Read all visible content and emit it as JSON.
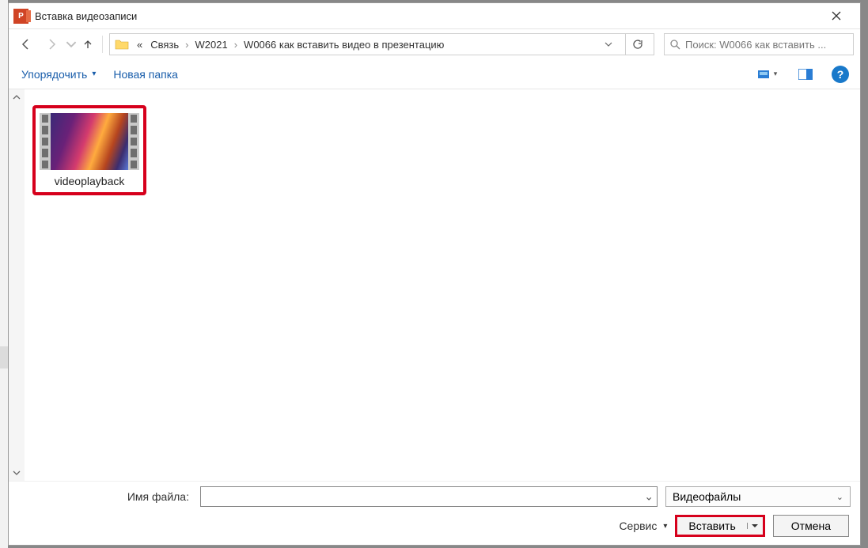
{
  "title": "Вставка видеозаписи",
  "breadcrumb": {
    "prefix": "«",
    "items": [
      "Связь",
      "W2021",
      "W0066 как вставить видео в презентацию"
    ]
  },
  "search": {
    "placeholder": "Поиск: W0066 как вставить ..."
  },
  "toolbar": {
    "organize": "Упорядочить",
    "new_folder": "Новая папка"
  },
  "files": {
    "items": [
      {
        "name": "videoplayback"
      }
    ]
  },
  "footer": {
    "filename_label": "Имя файла:",
    "filename_value": "",
    "filter": "Видеофайлы",
    "service": "Сервис",
    "insert": "Вставить",
    "cancel": "Отмена"
  }
}
